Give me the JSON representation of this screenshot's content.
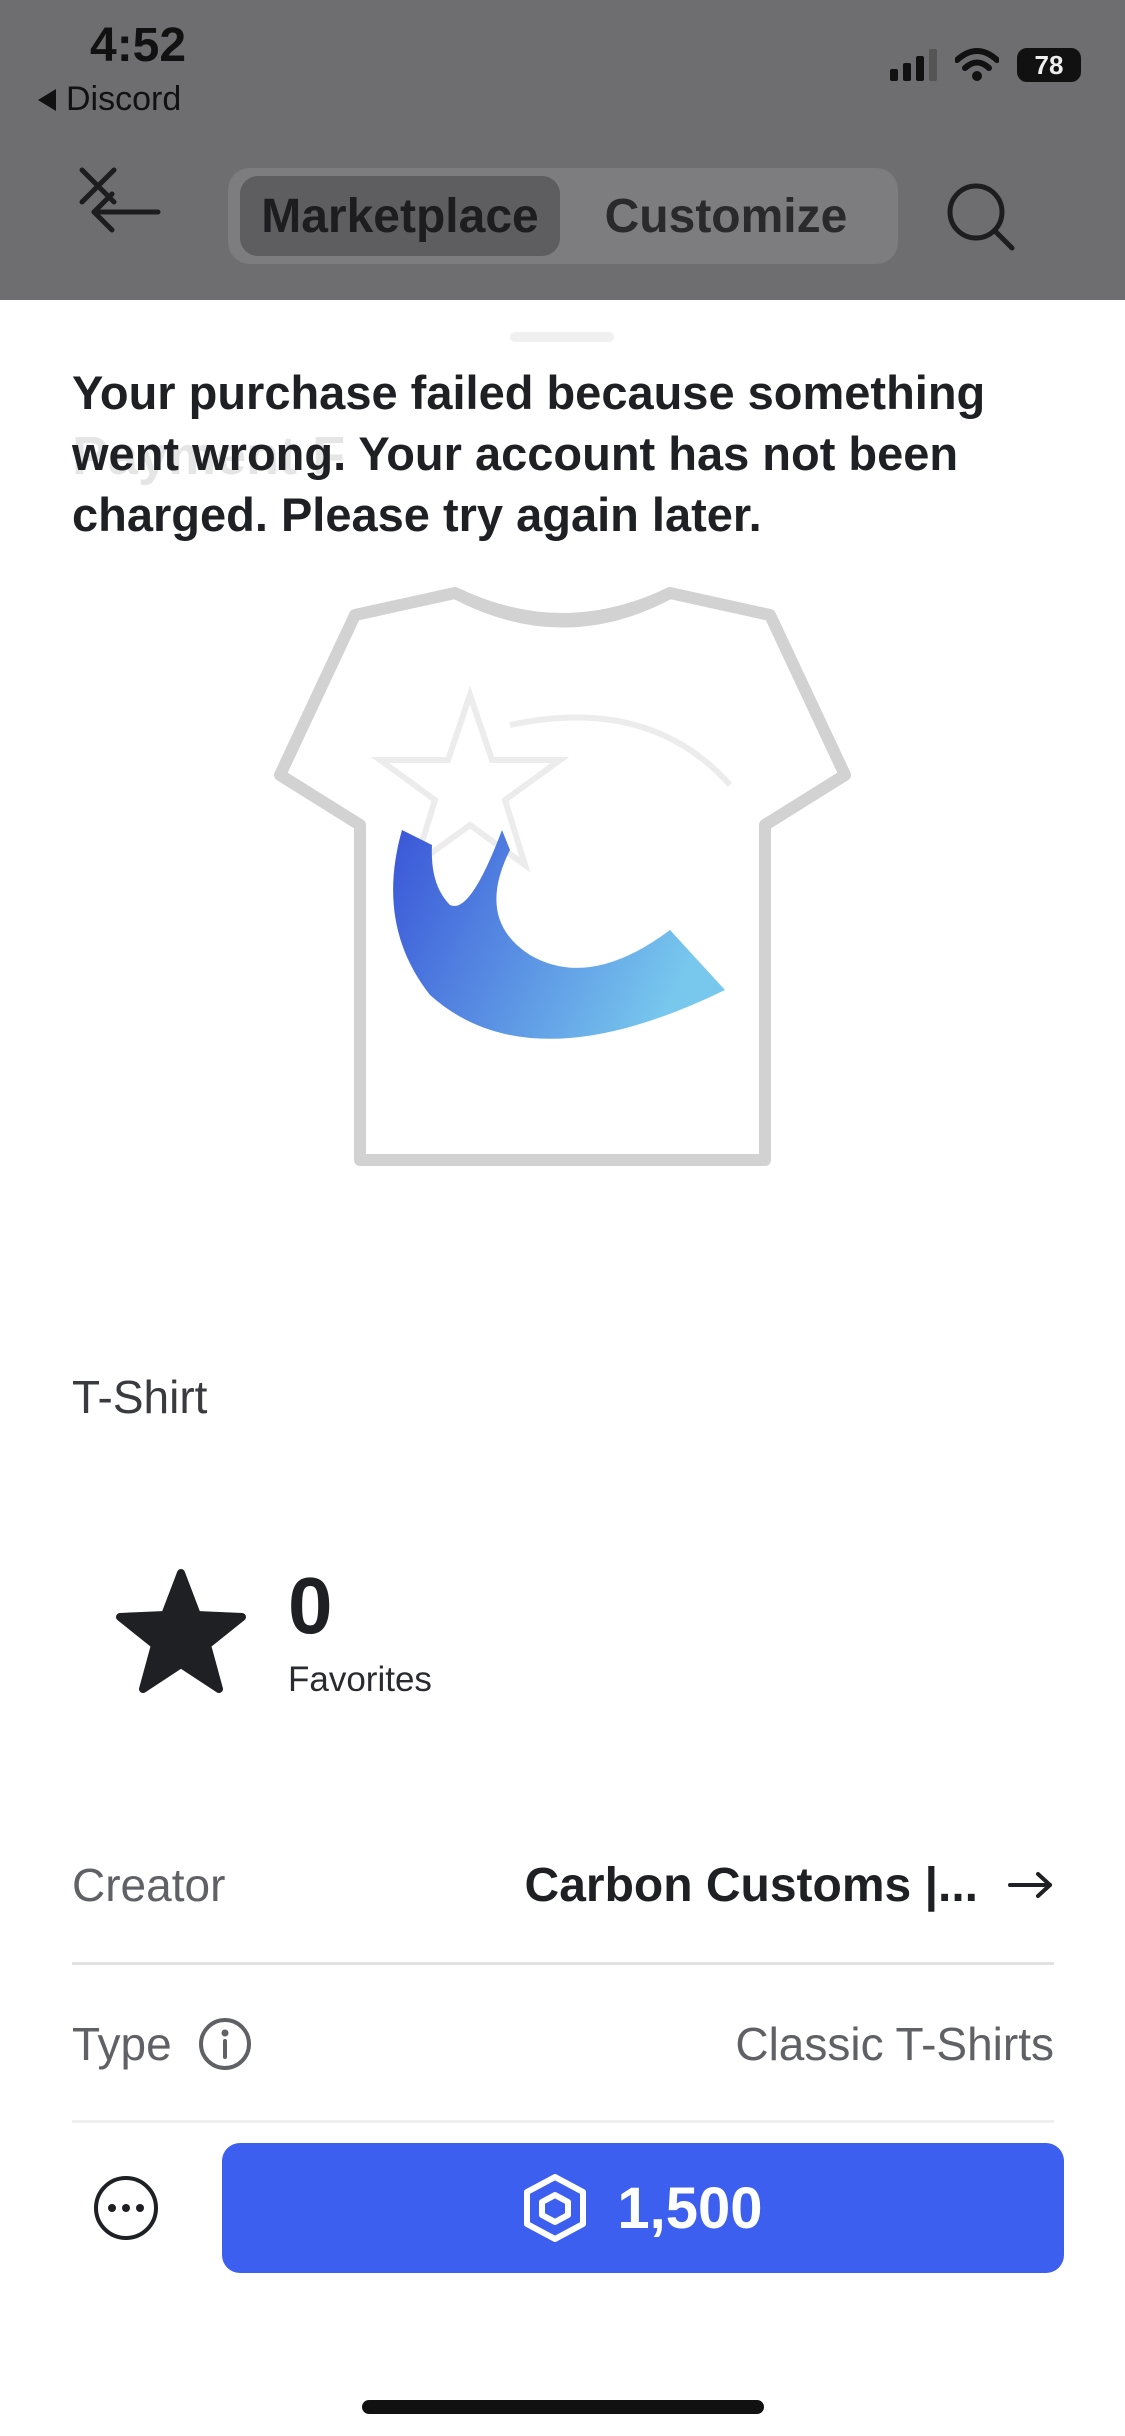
{
  "status_bar": {
    "time": "4:52",
    "back_app": "Discord",
    "battery": "78",
    "battery_level_percent": 78
  },
  "nav": {
    "tabs": [
      {
        "label": "Marketplace",
        "active": true
      },
      {
        "label": "Customize",
        "active": false
      }
    ]
  },
  "sheet": {
    "ghost_title": "Payment F",
    "error_message": "Your purchase failed because something went wrong. Your account has not been charged. Please try again later."
  },
  "item": {
    "category": "T-Shirt",
    "favorites_count": "0",
    "favorites_label": "Favorites",
    "details": [
      {
        "label": "Creator",
        "value": "Carbon Customs |..."
      },
      {
        "label": "Type",
        "value": "Classic T-Shirts"
      }
    ]
  },
  "purchase": {
    "price": "1,500"
  },
  "colors": {
    "buy_button": "#3c5ff0",
    "overlay": "#6e6e70"
  },
  "icons": {
    "close": "close-back-icon",
    "search": "search-icon",
    "star": "star-icon",
    "info": "info-icon",
    "arrow": "arrow-right-icon",
    "more": "more-icon",
    "currency": "robux-icon"
  }
}
